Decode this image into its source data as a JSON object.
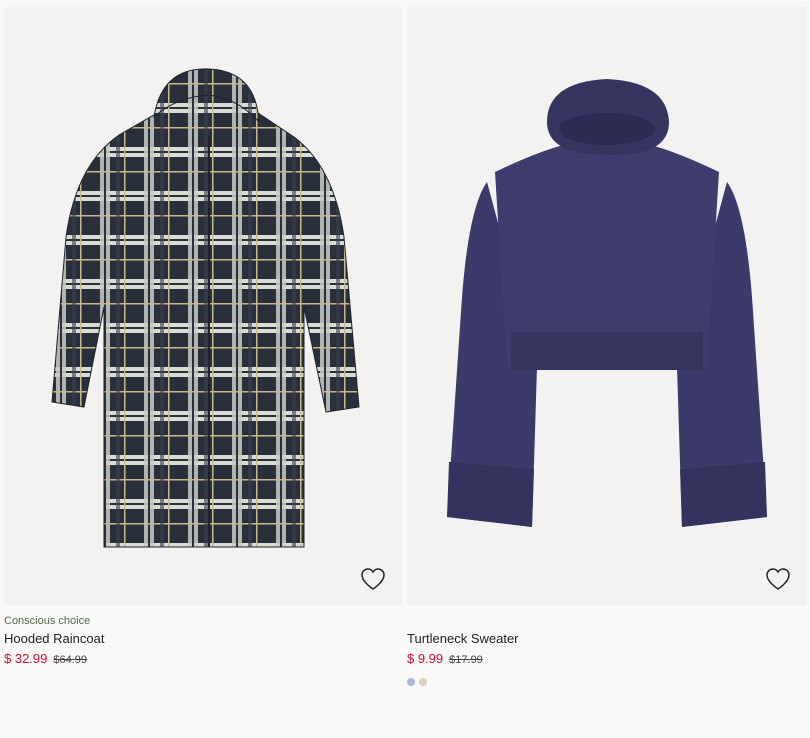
{
  "products": [
    {
      "tag": "Conscious choice",
      "name": "Hooded Raincoat",
      "price": "$ 32.99",
      "old_price": "$64.99",
      "favorite_icon": "heart-outline-icon",
      "swatches": []
    },
    {
      "tag": "",
      "name": "Turtleneck Sweater",
      "price": "$ 9.99",
      "old_price": "$17.99",
      "favorite_icon": "heart-outline-icon",
      "swatches": [
        "#a9b7d8",
        "#d8cfbe"
      ]
    }
  ],
  "colors": {
    "sale": "#c5103c",
    "conscious": "#4f6b4e",
    "image_bg": "#f3f2f1",
    "sweater": "#3b3a6a",
    "raincoat": "#2a2f3c"
  }
}
